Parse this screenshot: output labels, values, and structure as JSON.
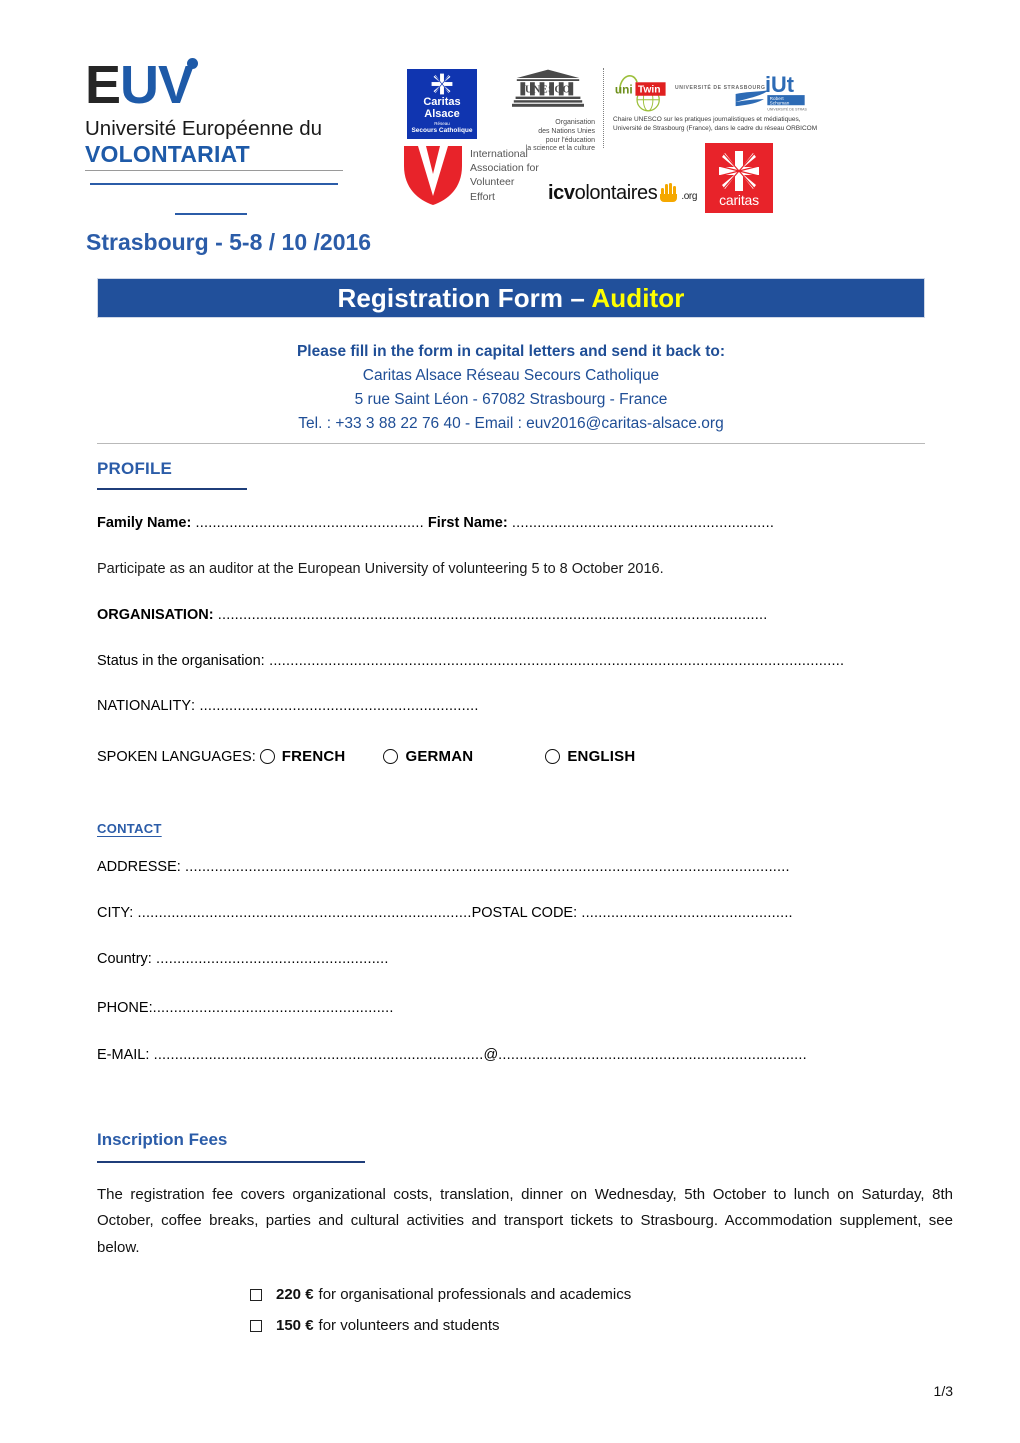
{
  "header": {
    "euv": {
      "acronym_e": "E",
      "acronym_uv": "UV",
      "line2": "Université Européenne du",
      "line3": "VOLONTARIAT"
    },
    "event_location_dates": "Strasbourg - 5-8 / 10 /2016",
    "logos": {
      "caritas_alsace": {
        "name_line1": "Caritas",
        "name_line2": "Alsace",
        "sub1": "Réseau",
        "sub2": "Secours Catholique"
      },
      "unesco": {
        "wordmark": "UNESCO",
        "caption": "Organisation\ndes Nations Unies\npour l'éducation\nla science et la culture"
      },
      "unitwin": {
        "wordmark_uni": "uni",
        "wordmark_twin": "Twin"
      },
      "unistra": {
        "wordmark": "UNIVERSITÉ DE STRASBOURG"
      },
      "iut": {
        "wordmark": "iUt",
        "sub_line1": "Robert",
        "sub_line2": "Schuman",
        "sub_line3": "UNIVERSITÉ DE STRASBOURG"
      },
      "chaire_caption_line1": "Chaire UNESCO sur les pratiques journalistiques et médiatiques,",
      "chaire_caption_line2": "Université de Strasbourg (France), dans le cadre du réseau ORBICOM",
      "iave": {
        "line1": "International",
        "line2": "Association for",
        "line3": "Volunteer",
        "line4": "Effort"
      },
      "icvolontaires": {
        "bold": "icv",
        "rest": "olontaires",
        "tld": ".org"
      },
      "caritas": {
        "name": "caritas"
      }
    }
  },
  "banner": {
    "title_main": "Registration Form – ",
    "title_accent": "Auditor"
  },
  "contact_header": {
    "instruction": "Please fill in the form in capital letters and send it back to:",
    "org": "Caritas Alsace Réseau Secours Catholique",
    "address": "5 rue Saint Léon - 67082 Strasbourg - France",
    "tel_email": "Tel. : +33 3 88 22 76 40 - Email : euv2016@caritas-alsace.org"
  },
  "profile": {
    "heading": "PROFILE",
    "family_name_label": "Family Name:",
    "family_name_dots": " ......................................................",
    "first_name_label": " First Name:",
    "first_name_dots": " ..............................................................",
    "participation_note": "Participate as an auditor at the European University of volunteering 5 to 8 October 2016.",
    "organisation_label": "ORGANISATION:",
    "organisation_dots": " ..................................................................................................................................",
    "status_label": "Status in the organisation",
    "status_dots": ": ........................................................................................................................................",
    "nationality_label": "NATIONALITY",
    "nationality_dots": ": ..................................................................",
    "spoken_languages_label": "SPOKEN LANGUAGES: ",
    "languages": [
      {
        "label": "FRENCH"
      },
      {
        "label": "GERMAN"
      },
      {
        "label": "ENGLISH"
      }
    ]
  },
  "contact": {
    "heading": "CONTACT",
    "address_label": "ADDRESSE:",
    "address_dots": " ...............................................................................................................................................",
    "city_label": "CITY:",
    "city_dots": " ...............................................................................",
    "postal_label": "POSTAL CODE:",
    "postal_dots": " ..................................................",
    "country_label": "Country:",
    "country_dots": " .......................................................",
    "phone_label": "PHONE:",
    "phone_dots": ".........................................................",
    "email_label": "E-MAIL:",
    "email_dots_left": " ..............................................................................",
    "email_at": "@",
    "email_dots_right": "........................................................................."
  },
  "fees": {
    "heading": "Inscription Fees",
    "paragraph": "The registration fee covers organizational costs, translation, dinner on Wednesday, 5th October to lunch on Saturday, 8th October, coffee breaks, parties and cultural activities and transport tickets to Strasbourg. Accommodation supplement, see below.",
    "options": [
      {
        "amount": "220 €",
        "description": "for organisational professionals and academics"
      },
      {
        "amount": "150 €",
        "description": "for volunteers and students"
      }
    ]
  },
  "footer": {
    "page_number": "1/3"
  },
  "colors": {
    "banner_blue": "#21509B",
    "accent_yellow": "#FFFF00",
    "heading_blue": "#2B5CA8",
    "text_blue": "#1F4E96",
    "caritas_red": "#E8232A",
    "caritas_alsace_blue": "#1035B0"
  }
}
